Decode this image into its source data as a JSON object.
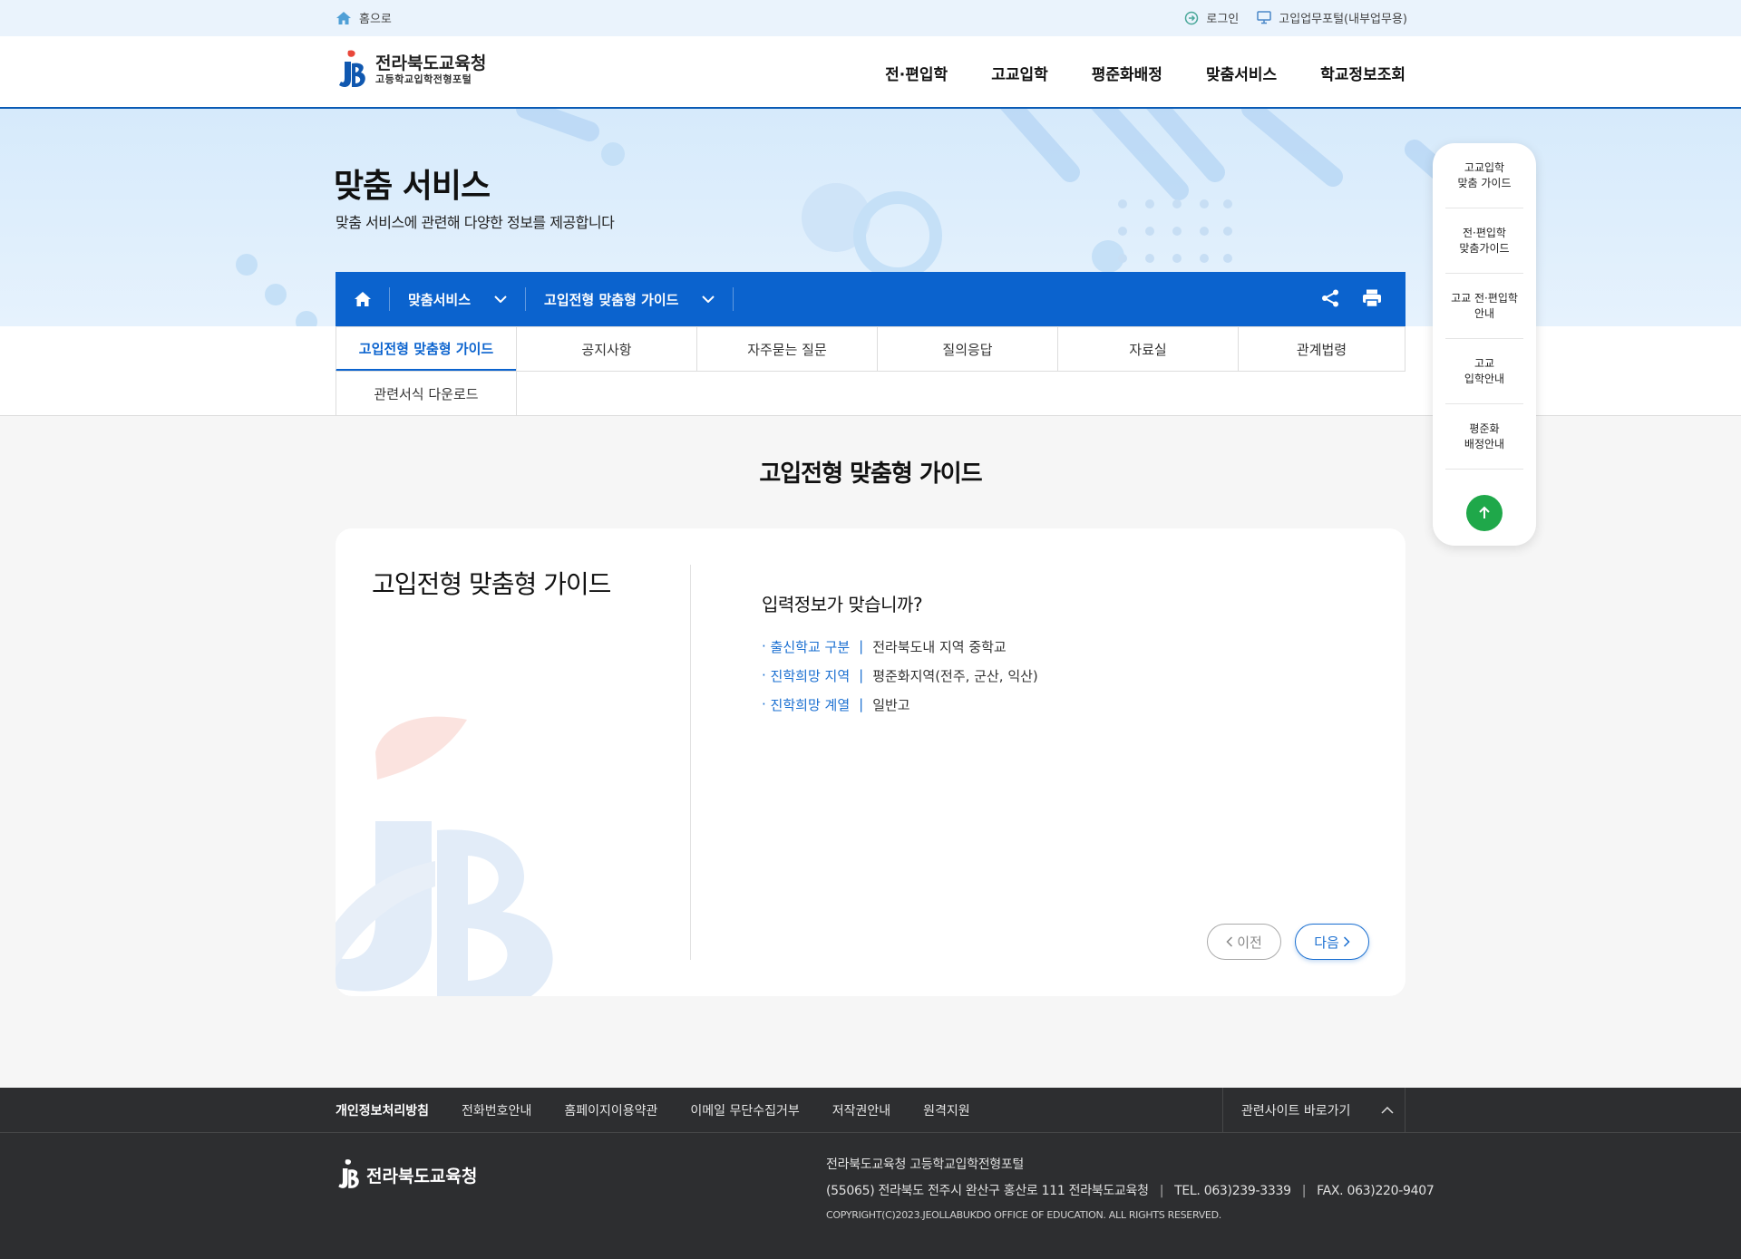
{
  "util": {
    "home_label": "홈으로",
    "login_label": "로그인",
    "portal_label": "고입업무포털(내부업무용)"
  },
  "header": {
    "logo_title": "전라북도교육청",
    "logo_subtitle": "고등학교입학전형포털",
    "nav": [
      "전·편입학",
      "고교입학",
      "평준화배정",
      "맞춤서비스",
      "학교정보조회"
    ]
  },
  "banner": {
    "title": "맞춤 서비스",
    "subtitle": "맞춤 서비스에 관련해 다양한 정보를 제공합니다"
  },
  "location": {
    "depth1": "맞춤서비스",
    "depth2": "고입전형 맞춤형 가이드"
  },
  "tabs": [
    "고입전형 맞춤형 가이드",
    "공지사항",
    "자주묻는 질문",
    "질의응답",
    "자료실",
    "관계법령",
    "관련서식 다운로드"
  ],
  "content": {
    "title": "고입전형 맞춤형 가이드",
    "card_title": "고입전형 맞춤형 가이드",
    "question": "입력정보가 맞습니까?",
    "items": [
      {
        "label": "출신학교 구분",
        "value": "전라북도내 지역 중학교"
      },
      {
        "label": "진학희망 지역",
        "value": "평준화지역(전주, 군산, 익산)"
      },
      {
        "label": "진학희망 계열",
        "value": "일반고"
      }
    ],
    "prev_label": "이전",
    "next_label": "다음"
  },
  "quick_menu": [
    "고교입학\n맞춤 가이드",
    "전·편입학\n맞춤가이드",
    "고교 전·편입학\n안내",
    "고교\n입학안내",
    "평준화\n배정안내"
  ],
  "footer": {
    "links": [
      "개인정보처리방침",
      "전화번호안내",
      "홈페이지이용약관",
      "이메일 무단수집거부",
      "저작권안내",
      "원격지원"
    ],
    "related_label": "관련사이트 바로가기",
    "logo_text": "전라북도교육청",
    "org": "전라북도교육청 고등학교입학전형포털",
    "address": "(55065) 전라북도 전주시 완산구 홍산로 111 전라북도교육청",
    "tel": "TEL. 063)239-3339",
    "fax": "FAX. 063)220-9407",
    "copyright": "COPYRIGHT(C)2023.JEOLLABUKDO OFFICE OF EDUCATION. ALL RIGHTS RESERVED."
  },
  "colors": {
    "primary": "#0b63ce",
    "accent_label": "#1a6fd1",
    "quick_top": "#1fa84a",
    "footer_bg": "#2d2e30"
  }
}
